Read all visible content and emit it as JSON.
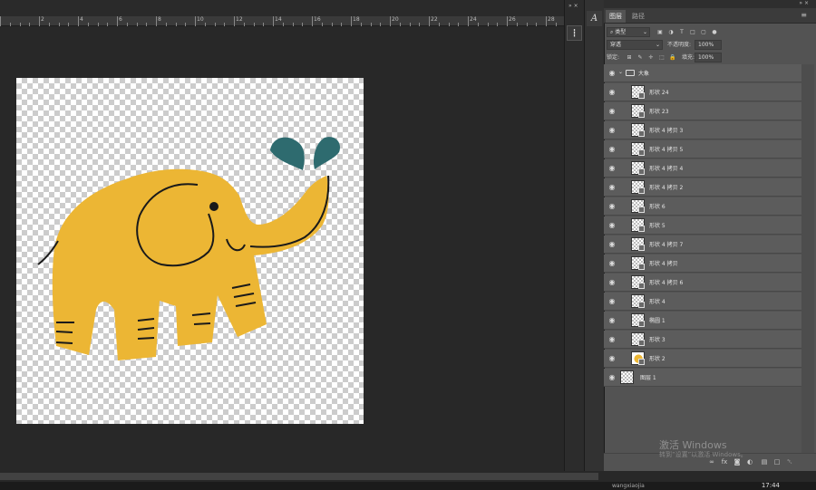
{
  "ruler": {
    "numbers": [
      "2",
      "4",
      "6",
      "8",
      "10",
      "12",
      "14",
      "16",
      "18",
      "20",
      "22",
      "24",
      "26",
      "28",
      "30"
    ]
  },
  "toolstrip": {
    "collapse_label": "» ×",
    "tool_icon": "properties-icon",
    "tool_glyph": "┇"
  },
  "charstrip": {
    "collapse_label": "»",
    "character_icon": "character-icon",
    "character_glyph": "A"
  },
  "panel": {
    "collapse_label": "» ×",
    "tabs": [
      {
        "label": "图层",
        "active": true
      },
      {
        "label": "路径",
        "active": false
      }
    ],
    "menu_glyph": "≡",
    "filter": {
      "kind_label": "⌕ 类型",
      "filter_icons": [
        "pixel-filter-icon",
        "adjustment-filter-icon",
        "type-filter-icon",
        "shape-filter-icon",
        "smart-object-filter-icon",
        "toggle-filter-icon"
      ],
      "filter_glyphs": [
        "▣",
        "◑",
        "T",
        "□",
        "▢",
        "●"
      ]
    },
    "blend": {
      "mode": "穿透",
      "opacity_label": "不透明度:",
      "opacity_value": "100%"
    },
    "lock": {
      "label": "锁定:",
      "icons": [
        "lock-transparent-icon",
        "lock-paint-icon",
        "lock-move-icon",
        "lock-artboard-icon",
        "lock-all-icon"
      ],
      "glyphs": [
        "⊞",
        "✎",
        "✛",
        "⬚",
        "🔒"
      ],
      "fill_label": "填充:",
      "fill_value": "100%"
    },
    "layers": [
      {
        "name": "大象",
        "type": "group"
      },
      {
        "name": "形状 24",
        "type": "shape"
      },
      {
        "name": "形状 23",
        "type": "shape"
      },
      {
        "name": "形状 4 拷贝 3",
        "type": "shape"
      },
      {
        "name": "形状 4 拷贝 5",
        "type": "shape"
      },
      {
        "name": "形状 4 拷贝 4",
        "type": "shape"
      },
      {
        "name": "形状 4 拷贝 2",
        "type": "shape"
      },
      {
        "name": "形状 6",
        "type": "shape"
      },
      {
        "name": "形状 5",
        "type": "shape"
      },
      {
        "name": "形状 4 拷贝 7",
        "type": "shape"
      },
      {
        "name": "形状 4 拷贝",
        "type": "shape"
      },
      {
        "name": "形状 4 拷贝 6",
        "type": "shape"
      },
      {
        "name": "形状 4",
        "type": "shape"
      },
      {
        "name": "椭圆 1",
        "type": "shape"
      },
      {
        "name": "形状 3",
        "type": "shape"
      },
      {
        "name": "形状 2",
        "type": "shape"
      },
      {
        "name": "图层 1",
        "type": "pixel"
      }
    ],
    "bottom_icons": [
      "link-layers-icon",
      "fx-icon",
      "mask-icon",
      "adjustment-icon",
      "new-group-icon",
      "new-layer-icon",
      "delete-icon"
    ],
    "bottom_glyphs": [
      "∞",
      "fx",
      "◙",
      "◐",
      "▤",
      "□",
      "␡"
    ]
  },
  "watermark": {
    "line1": "激活 Windows",
    "line2": "转到“设置”以激活 Windows。"
  },
  "taskbar": {
    "item": "wangxiaojia",
    "clock": "17:44"
  },
  "colors": {
    "elephant": "#ecb634",
    "water": "#2e6b6f",
    "outline": "#1a1a1a"
  }
}
